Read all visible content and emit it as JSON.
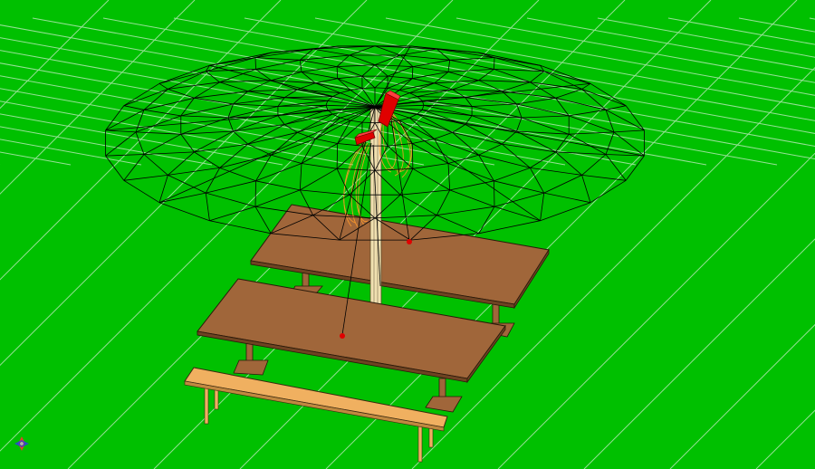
{
  "viewport": {
    "background_color": "#00c000",
    "grid_color": "#d8f0d8",
    "wireframe_color": "#000000"
  },
  "scene": {
    "objects": [
      {
        "name": "umbrella-canopy-wireframe",
        "color": "#000000"
      },
      {
        "name": "umbrella-pole",
        "color": "#f0e0b0"
      },
      {
        "name": "light-fixture-upper",
        "color": "#e00000"
      },
      {
        "name": "light-fixture-lower",
        "color": "#e00000"
      },
      {
        "name": "table-top-rear",
        "color": "#a0663a"
      },
      {
        "name": "table-top-front",
        "color": "#a0663a"
      },
      {
        "name": "bench",
        "color": "#f0b060"
      }
    ],
    "light_rays_color": "#ff9a2a"
  },
  "view_cube": {
    "icon": "axis-gizmo-icon",
    "axis_colors": [
      "#ff3030",
      "#3030ff",
      "#b0b0b0"
    ]
  }
}
